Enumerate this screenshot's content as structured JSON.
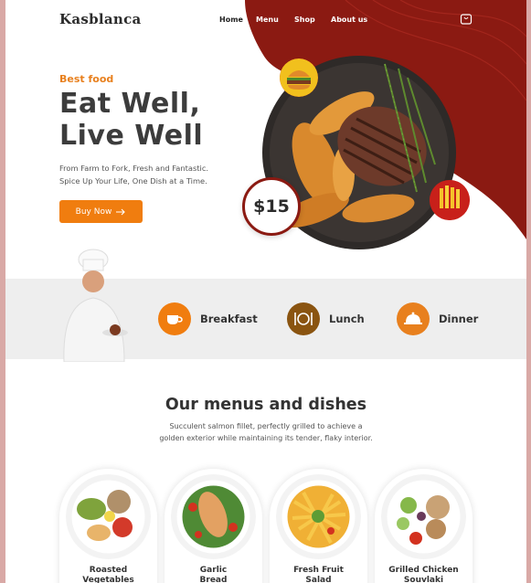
{
  "brand": {
    "name": "Kasblanca"
  },
  "nav": {
    "items": [
      "Home",
      "Menu",
      "Shop",
      "About us"
    ]
  },
  "hero": {
    "kicker": "Best food",
    "title_line1": "Eat Well,",
    "title_line2": "Live Well",
    "subtitle_line1": "From Farm to Fork, Fresh and Fantastic.",
    "subtitle_line2": "Spice Up Your Life, One Dish at a Time.",
    "cta": "Buy Now",
    "price": "$15"
  },
  "categories": [
    {
      "label": "Breakfast",
      "icon": "coffee-cup-icon",
      "color": "#f07d0f"
    },
    {
      "label": "Lunch",
      "icon": "plate-cutlery-icon",
      "color": "#8a5410"
    },
    {
      "label": "Dinner",
      "icon": "cloche-icon",
      "color": "#e8801e"
    }
  ],
  "menus": {
    "title": "Our menus and dishes",
    "desc_line1": "Succulent salmon fillet, perfectly grilled to achieve a",
    "desc_line2": "golden exterior while maintaining its tender, flaky interior.",
    "dishes": [
      {
        "name_line1": "Roasted",
        "name_line2": "Vegetables"
      },
      {
        "name_line1": "Garlic",
        "name_line2": "Bread"
      },
      {
        "name_line1": "Fresh Fruit",
        "name_line2": "Salad"
      },
      {
        "name_line1": "Grilled Chicken",
        "name_line2": "Souvlaki"
      }
    ]
  },
  "colors": {
    "accent": "#f07d0f",
    "brand_red": "#8b1a12",
    "band": "#eeeeee"
  }
}
